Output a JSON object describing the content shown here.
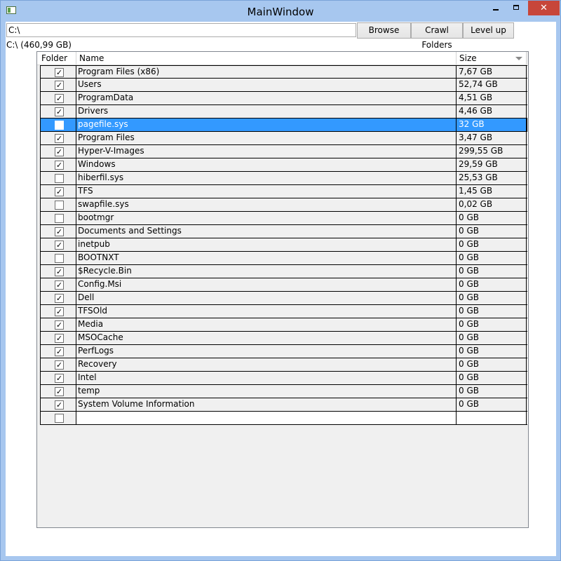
{
  "window": {
    "title": "MainWindow"
  },
  "toolbar": {
    "path_value": "C:\\",
    "browse_label": "Browse",
    "crawl_label": "Crawl Folders",
    "levelup_label": "Level up"
  },
  "summary": "C:\\ (460,99 GB)",
  "columns": {
    "folder": "Folder",
    "name": "Name",
    "size": "Size"
  },
  "rows": [
    {
      "folder": true,
      "name": "Program Files (x86)",
      "size": "7,67 GB"
    },
    {
      "folder": true,
      "name": "Users",
      "size": "52,74 GB"
    },
    {
      "folder": true,
      "name": "ProgramData",
      "size": "4,51 GB"
    },
    {
      "folder": true,
      "name": "Drivers",
      "size": "4,46 GB"
    },
    {
      "folder": false,
      "name": "pagefile.sys",
      "size": "32 GB",
      "selected": true
    },
    {
      "folder": true,
      "name": "Program Files",
      "size": "3,47 GB"
    },
    {
      "folder": true,
      "name": "Hyper-V-Images",
      "size": "299,55 GB"
    },
    {
      "folder": true,
      "name": "Windows",
      "size": "29,59 GB"
    },
    {
      "folder": false,
      "name": "hiberfil.sys",
      "size": "25,53 GB"
    },
    {
      "folder": true,
      "name": "TFS",
      "size": "1,45 GB"
    },
    {
      "folder": false,
      "name": "swapfile.sys",
      "size": "0,02 GB"
    },
    {
      "folder": false,
      "name": "bootmgr",
      "size": "0 GB"
    },
    {
      "folder": true,
      "name": "Documents and Settings",
      "size": "0 GB"
    },
    {
      "folder": true,
      "name": "inetpub",
      "size": "0 GB"
    },
    {
      "folder": false,
      "name": "BOOTNXT",
      "size": "0 GB"
    },
    {
      "folder": true,
      "name": "$Recycle.Bin",
      "size": "0 GB"
    },
    {
      "folder": true,
      "name": "Config.Msi",
      "size": "0 GB"
    },
    {
      "folder": true,
      "name": "Dell",
      "size": "0 GB"
    },
    {
      "folder": true,
      "name": "TFSOld",
      "size": "0 GB"
    },
    {
      "folder": true,
      "name": "Media",
      "size": "0 GB"
    },
    {
      "folder": true,
      "name": "MSOCache",
      "size": "0 GB"
    },
    {
      "folder": true,
      "name": "PerfLogs",
      "size": "0 GB"
    },
    {
      "folder": true,
      "name": "Recovery",
      "size": "0 GB"
    },
    {
      "folder": true,
      "name": "Intel",
      "size": "0 GB"
    },
    {
      "folder": true,
      "name": "temp",
      "size": "0 GB"
    },
    {
      "folder": true,
      "name": "System Volume Information",
      "size": "0 GB"
    },
    {
      "folder": false,
      "name": "",
      "size": "",
      "empty": true
    }
  ],
  "icons": {
    "minimize": "minimize-icon",
    "maximize": "maximize-icon",
    "close": "close-icon",
    "app": "app-window-icon",
    "check": "checkmark-icon",
    "sort": "sort-desc-icon"
  },
  "colors": {
    "titlebar": "#a7c7ef",
    "selection": "#3399ff",
    "close": "#c7463a"
  }
}
